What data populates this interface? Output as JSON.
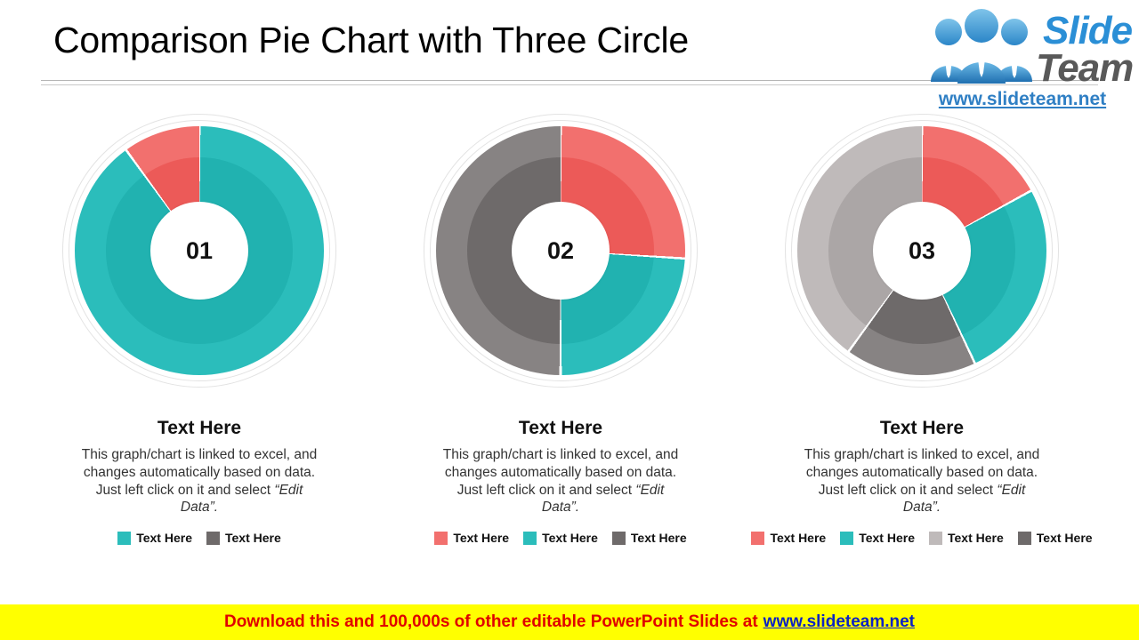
{
  "header": {
    "title": "Comparison Pie Chart with Three Circle"
  },
  "logo": {
    "brand_first": "Slide",
    "brand_second": "Team",
    "url": "www.slideteam.net",
    "icon": "three-people-icon",
    "brand_first_color": "#2b8fd6",
    "brand_second_color": "#595959"
  },
  "palette": {
    "teal": "#2bbdbb",
    "teal_inner": "#21b2b0",
    "red": "#f2706e",
    "red_inner": "#ec5a58",
    "gray_dark": "#878383",
    "gray_dark_inner": "#6e6a6a",
    "gray_light": "#bfbaba",
    "gray_light_inner": "#aba6a6",
    "ring_outline": "#e3e3e3",
    "hub_fill": "#ffffff"
  },
  "columns": [
    {
      "number": "01",
      "heading": "Text Here",
      "body_main": "This graph/chart is linked to excel, and changes automatically based on data. Just left click on it and select",
      "body_em": "“Edit Data”.",
      "legend": [
        {
          "label": "Text Here",
          "color": "#2bbdbb"
        },
        {
          "label": "Text Here",
          "color": "#6e6a6a"
        }
      ]
    },
    {
      "number": "02",
      "heading": "Text Here",
      "body_main": "This graph/chart is linked to excel, and changes automatically based on data. Just left click on it and select",
      "body_em": "“Edit Data”.",
      "legend": [
        {
          "label": "Text Here",
          "color": "#f2706e"
        },
        {
          "label": "Text Here",
          "color": "#2bbdbb"
        },
        {
          "label": "Text Here",
          "color": "#6e6a6a"
        }
      ]
    },
    {
      "number": "03",
      "heading": "Text Here",
      "body_main": "This graph/chart is linked to excel, and changes automatically based on data. Just left click on it and select",
      "body_em": "“Edit Data”.",
      "legend": [
        {
          "label": "Text Here",
          "color": "#f2706e"
        },
        {
          "label": "Text Here",
          "color": "#2bbdbb"
        },
        {
          "label": "Text Here",
          "color": "#bfbaba"
        },
        {
          "label": "Text Here",
          "color": "#6e6a6a"
        }
      ]
    }
  ],
  "footer": {
    "text": "Download this and 100,000s of other editable PowerPoint Slides at",
    "link": "www.slideteam.net",
    "background": "#ffff00",
    "text_color": "#e00000",
    "link_color": "#0b23c4"
  },
  "chart_data": [
    {
      "type": "pie",
      "title": "01",
      "labels": [
        "Text Here",
        "Text Here"
      ],
      "values": [
        90,
        10
      ],
      "colors": [
        "#2bbdbb",
        "#f2706e"
      ],
      "inner_colors": [
        "#21b2b0",
        "#ec5a58"
      ],
      "start_angle": 0,
      "donut": true,
      "legend_position": "bottom"
    },
    {
      "type": "pie",
      "title": "02",
      "labels": [
        "Text Here",
        "Text Here",
        "Text Here"
      ],
      "values": [
        26,
        24,
        50
      ],
      "colors": [
        "#f2706e",
        "#2bbdbb",
        "#878383"
      ],
      "inner_colors": [
        "#ec5a58",
        "#21b2b0",
        "#6e6a6a"
      ],
      "start_angle": 0,
      "donut": true,
      "legend_position": "bottom"
    },
    {
      "type": "pie",
      "title": "03",
      "labels": [
        "Text Here",
        "Text Here",
        "Text Here",
        "Text Here"
      ],
      "values": [
        17,
        26,
        17,
        40
      ],
      "colors": [
        "#f2706e",
        "#2bbdbb",
        "#878383",
        "#bfbaba"
      ],
      "inner_colors": [
        "#ec5a58",
        "#21b2b0",
        "#6e6a6a",
        "#aba6a6"
      ],
      "start_angle": 0,
      "donut": true,
      "legend_position": "bottom"
    }
  ]
}
